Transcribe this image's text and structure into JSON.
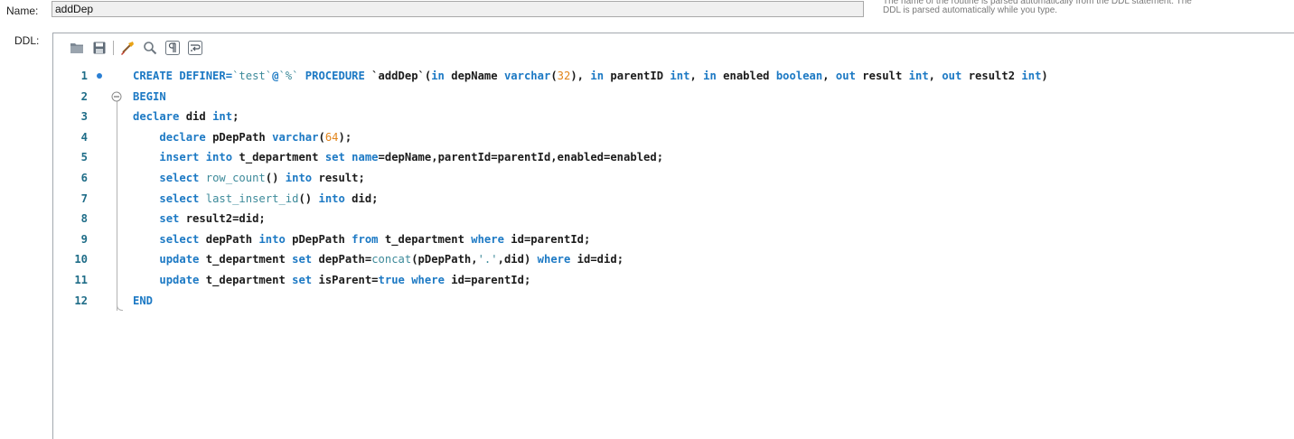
{
  "name_label": "Name:",
  "name_value": "addDep",
  "hint": "The name of the routine is parsed automatically from the DDL statement. The DDL is parsed automatically while you type.",
  "ddl_label": "DDL:",
  "toolbar": [
    "open-folder-icon",
    "save-icon",
    "beautify-icon",
    "find-icon",
    "invisible-chars-icon",
    "wrap-lines-icon"
  ],
  "line_numbers": [
    "1",
    "2",
    "3",
    "4",
    "5",
    "6",
    "7",
    "8",
    "9",
    "10",
    "11",
    "12"
  ],
  "code_lines": [
    [
      [
        "kw",
        "CREATE DEFINER="
      ],
      [
        "str",
        "`test`"
      ],
      [
        "kw",
        "@"
      ],
      [
        "str",
        "`%`"
      ],
      [
        "kw",
        " PROCEDURE "
      ],
      [
        "plain",
        "`addDep`("
      ],
      [
        "kw",
        "in "
      ],
      [
        "plain",
        "depName "
      ],
      [
        "kw",
        "varchar"
      ],
      [
        "plain",
        "("
      ],
      [
        "num",
        "32"
      ],
      [
        "plain",
        "), "
      ],
      [
        "kw",
        "in "
      ],
      [
        "plain",
        "parentID "
      ],
      [
        "kw",
        "int"
      ],
      [
        "plain",
        ", "
      ],
      [
        "kw",
        "in "
      ],
      [
        "plain",
        "enabled "
      ],
      [
        "kw",
        "boolean"
      ],
      [
        "plain",
        ", "
      ],
      [
        "kw",
        "out "
      ],
      [
        "plain",
        "result "
      ],
      [
        "kw",
        "int"
      ],
      [
        "plain",
        ", "
      ],
      [
        "kw",
        "out "
      ],
      [
        "plain",
        "result2 "
      ],
      [
        "kw",
        "int"
      ],
      [
        "plain",
        ")"
      ]
    ],
    [
      [
        "kw",
        "BEGIN"
      ]
    ],
    [
      [
        "kw",
        "declare "
      ],
      [
        "plain",
        "did "
      ],
      [
        "kw",
        "int"
      ],
      [
        "plain",
        ";"
      ]
    ],
    [
      [
        "plain",
        "    "
      ],
      [
        "kw",
        "declare "
      ],
      [
        "plain",
        "pDepPath "
      ],
      [
        "kw",
        "varchar"
      ],
      [
        "plain",
        "("
      ],
      [
        "num",
        "64"
      ],
      [
        "plain",
        ");"
      ]
    ],
    [
      [
        "plain",
        "    "
      ],
      [
        "kw",
        "insert into "
      ],
      [
        "plain",
        "t_department "
      ],
      [
        "kw",
        "set "
      ],
      [
        "kw",
        "name"
      ],
      [
        "plain",
        "=depName,parentId=parentId,enabled=enabled;"
      ]
    ],
    [
      [
        "plain",
        "    "
      ],
      [
        "kw",
        "select "
      ],
      [
        "fn",
        "row_count"
      ],
      [
        "plain",
        "() "
      ],
      [
        "kw",
        "into "
      ],
      [
        "plain",
        "result;"
      ]
    ],
    [
      [
        "plain",
        "    "
      ],
      [
        "kw",
        "select "
      ],
      [
        "fn",
        "last_insert_id"
      ],
      [
        "plain",
        "() "
      ],
      [
        "kw",
        "into "
      ],
      [
        "plain",
        "did;"
      ]
    ],
    [
      [
        "plain",
        "    "
      ],
      [
        "kw",
        "set "
      ],
      [
        "plain",
        "result2=did;"
      ]
    ],
    [
      [
        "plain",
        "    "
      ],
      [
        "kw",
        "select "
      ],
      [
        "plain",
        "depPath "
      ],
      [
        "kw",
        "into "
      ],
      [
        "plain",
        "pDepPath "
      ],
      [
        "kw",
        "from "
      ],
      [
        "plain",
        "t_department "
      ],
      [
        "kw",
        "where "
      ],
      [
        "plain",
        "id=parentId;"
      ]
    ],
    [
      [
        "plain",
        "    "
      ],
      [
        "kw",
        "update "
      ],
      [
        "plain",
        "t_department "
      ],
      [
        "kw",
        "set "
      ],
      [
        "plain",
        "depPath="
      ],
      [
        "fn",
        "concat"
      ],
      [
        "plain",
        "(pDepPath,"
      ],
      [
        "str",
        "'.'"
      ],
      [
        "plain",
        ",did) "
      ],
      [
        "kw",
        "where "
      ],
      [
        "plain",
        "id=did;"
      ]
    ],
    [
      [
        "plain",
        "    "
      ],
      [
        "kw",
        "update "
      ],
      [
        "plain",
        "t_department "
      ],
      [
        "kw",
        "set "
      ],
      [
        "plain",
        "isParent="
      ],
      [
        "kw",
        "true "
      ],
      [
        "kw",
        "where "
      ],
      [
        "plain",
        "id=parentId;"
      ]
    ],
    [
      [
        "kw",
        "END"
      ]
    ]
  ]
}
